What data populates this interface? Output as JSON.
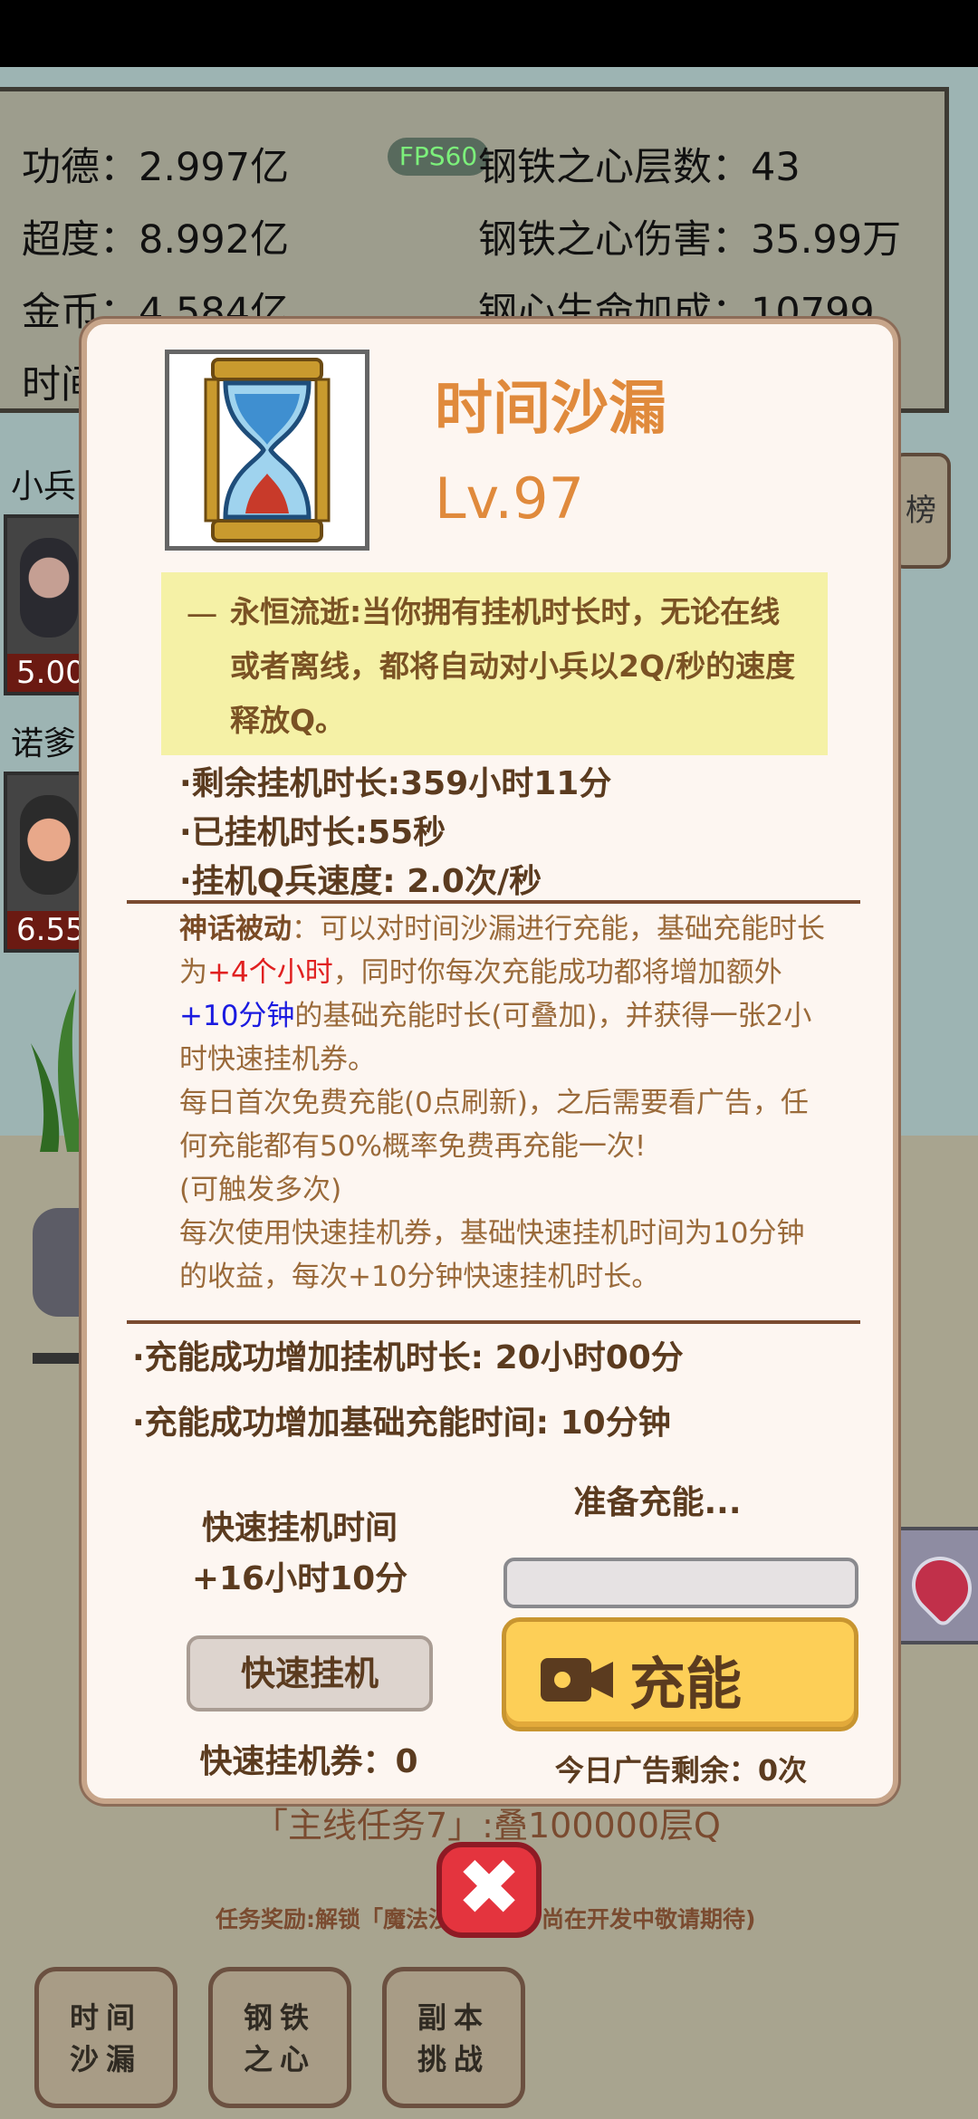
{
  "stats": {
    "merit": "功德：2.997亿",
    "transcend": "超度：8.992亿",
    "gold": "金币：4.584亿",
    "time_prefix": "时间",
    "fps": "FPS60",
    "steel_layers": "钢铁之心层数：43",
    "steel_damage": "钢铁之心伤害：35.99万",
    "steel_hp": "钢心生命加成：10799"
  },
  "side": {
    "soldier_label": "小兵",
    "soldier_value": "5.00",
    "boss_label": "诺爹",
    "boss_value": "6.55",
    "rank_label": "榜"
  },
  "modal": {
    "title": "时间沙漏",
    "level": "Lv.97",
    "skill_dash": "一",
    "skill_text": "永恒流逝:当你拥有挂机时长时，无论在线或者离线，都将自动对小兵以2Q/秒的速度释放Q。",
    "remaining": "·剩余挂机时长:359小时11分",
    "elapsed": "·已挂机时长:55秒",
    "speed": "·挂机Q兵速度: 2.0次/秒",
    "desc": {
      "myth_label": "神话被动",
      "p1a": "：可以对时间沙漏进行充能，基础充能时长为",
      "p1_red": "+4个小时",
      "p1b": "，同时你每次充能成功都将增加额外",
      "p1_blue": "+10分钟",
      "p1c": "的基础充能时长(可叠加)，并获得一张2小时快速挂机券。",
      "p2": "每日首次免费充能(0点刷新)，之后需要看广告，任何充能都有50%概率免费再充能一次!",
      "p3": "(可触发多次)",
      "p4": "每次使用快速挂机券，基础快速挂机时间为10分钟的收益，每次+10分钟快速挂机时长。"
    },
    "charge_add_time": "·充能成功增加挂机时长: 20小时00分",
    "charge_add_base": "·充能成功增加基础充能时间: 10分钟",
    "quick_title": "快速挂机时间",
    "quick_value": "+16小时10分",
    "quick_button": "快速挂机",
    "ticket": "快速挂机券：0",
    "prepare": "准备充能...",
    "charge_progress": 0,
    "charge_button": "充能",
    "ads_left": "今日广告剩余：0次"
  },
  "task": {
    "title": "「主线任务7」:叠100000层Q",
    "reward": "任务奖励:解锁「魔法沙",
    "reward_tail": "尚在开发中敬请期待)"
  },
  "close_label": "✖",
  "nav": [
    {
      "line1": "时间",
      "line2": "沙漏"
    },
    {
      "line1": "钢铁",
      "line2": "之心"
    },
    {
      "line1": "副本",
      "line2": "挑战"
    }
  ],
  "colors": {
    "accent_orange": "#e08a3c",
    "charge_yellow": "#fdcf57",
    "close_red": "#e4343e",
    "skill_bg": "#f5f1a6"
  }
}
